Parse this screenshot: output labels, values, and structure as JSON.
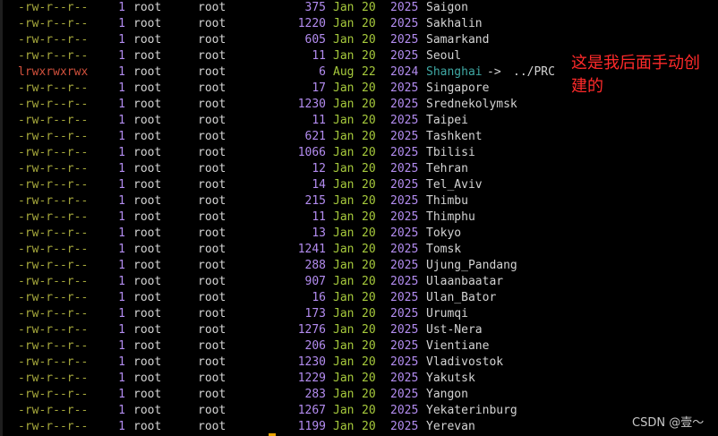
{
  "listing": {
    "entries": [
      {
        "perm": "-rw-r--r--",
        "links": "1",
        "owner": "root",
        "group": "root",
        "size": "375",
        "month": "Jan",
        "day": "20",
        "year": "2025",
        "name": "Saigon"
      },
      {
        "perm": "-rw-r--r--",
        "links": "1",
        "owner": "root",
        "group": "root",
        "size": "1220",
        "month": "Jan",
        "day": "20",
        "year": "2025",
        "name": "Sakhalin"
      },
      {
        "perm": "-rw-r--r--",
        "links": "1",
        "owner": "root",
        "group": "root",
        "size": "605",
        "month": "Jan",
        "day": "20",
        "year": "2025",
        "name": "Samarkand"
      },
      {
        "perm": "-rw-r--r--",
        "links": "1",
        "owner": "root",
        "group": "root",
        "size": "11",
        "month": "Jan",
        "day": "20",
        "year": "2025",
        "name": "Seoul"
      },
      {
        "perm": "lrwxrwxrwx",
        "links": "1",
        "owner": "root",
        "group": "root",
        "size": "6",
        "month": "Aug",
        "day": "22",
        "year": "2024",
        "name": "Shanghai",
        "arrow": "->",
        "target": "../PRC",
        "is_link": true
      },
      {
        "perm": "-rw-r--r--",
        "links": "1",
        "owner": "root",
        "group": "root",
        "size": "17",
        "month": "Jan",
        "day": "20",
        "year": "2025",
        "name": "Singapore"
      },
      {
        "perm": "-rw-r--r--",
        "links": "1",
        "owner": "root",
        "group": "root",
        "size": "1230",
        "month": "Jan",
        "day": "20",
        "year": "2025",
        "name": "Srednekolymsk"
      },
      {
        "perm": "-rw-r--r--",
        "links": "1",
        "owner": "root",
        "group": "root",
        "size": "11",
        "month": "Jan",
        "day": "20",
        "year": "2025",
        "name": "Taipei"
      },
      {
        "perm": "-rw-r--r--",
        "links": "1",
        "owner": "root",
        "group": "root",
        "size": "621",
        "month": "Jan",
        "day": "20",
        "year": "2025",
        "name": "Tashkent"
      },
      {
        "perm": "-rw-r--r--",
        "links": "1",
        "owner": "root",
        "group": "root",
        "size": "1066",
        "month": "Jan",
        "day": "20",
        "year": "2025",
        "name": "Tbilisi"
      },
      {
        "perm": "-rw-r--r--",
        "links": "1",
        "owner": "root",
        "group": "root",
        "size": "12",
        "month": "Jan",
        "day": "20",
        "year": "2025",
        "name": "Tehran"
      },
      {
        "perm": "-rw-r--r--",
        "links": "1",
        "owner": "root",
        "group": "root",
        "size": "14",
        "month": "Jan",
        "day": "20",
        "year": "2025",
        "name": "Tel_Aviv"
      },
      {
        "perm": "-rw-r--r--",
        "links": "1",
        "owner": "root",
        "group": "root",
        "size": "215",
        "month": "Jan",
        "day": "20",
        "year": "2025",
        "name": "Thimbu"
      },
      {
        "perm": "-rw-r--r--",
        "links": "1",
        "owner": "root",
        "group": "root",
        "size": "11",
        "month": "Jan",
        "day": "20",
        "year": "2025",
        "name": "Thimphu"
      },
      {
        "perm": "-rw-r--r--",
        "links": "1",
        "owner": "root",
        "group": "root",
        "size": "13",
        "month": "Jan",
        "day": "20",
        "year": "2025",
        "name": "Tokyo"
      },
      {
        "perm": "-rw-r--r--",
        "links": "1",
        "owner": "root",
        "group": "root",
        "size": "1241",
        "month": "Jan",
        "day": "20",
        "year": "2025",
        "name": "Tomsk"
      },
      {
        "perm": "-rw-r--r--",
        "links": "1",
        "owner": "root",
        "group": "root",
        "size": "288",
        "month": "Jan",
        "day": "20",
        "year": "2025",
        "name": "Ujung_Pandang"
      },
      {
        "perm": "-rw-r--r--",
        "links": "1",
        "owner": "root",
        "group": "root",
        "size": "907",
        "month": "Jan",
        "day": "20",
        "year": "2025",
        "name": "Ulaanbaatar"
      },
      {
        "perm": "-rw-r--r--",
        "links": "1",
        "owner": "root",
        "group": "root",
        "size": "16",
        "month": "Jan",
        "day": "20",
        "year": "2025",
        "name": "Ulan_Bator"
      },
      {
        "perm": "-rw-r--r--",
        "links": "1",
        "owner": "root",
        "group": "root",
        "size": "173",
        "month": "Jan",
        "day": "20",
        "year": "2025",
        "name": "Urumqi"
      },
      {
        "perm": "-rw-r--r--",
        "links": "1",
        "owner": "root",
        "group": "root",
        "size": "1276",
        "month": "Jan",
        "day": "20",
        "year": "2025",
        "name": "Ust-Nera"
      },
      {
        "perm": "-rw-r--r--",
        "links": "1",
        "owner": "root",
        "group": "root",
        "size": "206",
        "month": "Jan",
        "day": "20",
        "year": "2025",
        "name": "Vientiane"
      },
      {
        "perm": "-rw-r--r--",
        "links": "1",
        "owner": "root",
        "group": "root",
        "size": "1230",
        "month": "Jan",
        "day": "20",
        "year": "2025",
        "name": "Vladivostok"
      },
      {
        "perm": "-rw-r--r--",
        "links": "1",
        "owner": "root",
        "group": "root",
        "size": "1229",
        "month": "Jan",
        "day": "20",
        "year": "2025",
        "name": "Yakutsk"
      },
      {
        "perm": "-rw-r--r--",
        "links": "1",
        "owner": "root",
        "group": "root",
        "size": "283",
        "month": "Jan",
        "day": "20",
        "year": "2025",
        "name": "Yangon"
      },
      {
        "perm": "-rw-r--r--",
        "links": "1",
        "owner": "root",
        "group": "root",
        "size": "1267",
        "month": "Jan",
        "day": "20",
        "year": "2025",
        "name": "Yekaterinburg"
      },
      {
        "perm": "-rw-r--r--",
        "links": "1",
        "owner": "root",
        "group": "root",
        "size": "1199",
        "month": "Jan",
        "day": "20",
        "year": "2025",
        "name": "Yerevan"
      }
    ]
  },
  "annotation": {
    "text": "这是我后面手动创建的"
  },
  "watermark": {
    "text": "CSDN @壹～"
  },
  "colors": {
    "background": "#000000",
    "perm_file": "#a6a83c",
    "perm_link": "#d0503c",
    "number": "#b38cf0",
    "date": "#a6c93c",
    "symlink_name": "#3fa8a4",
    "text": "#d4d4d4",
    "annotation": "#ff2a2a"
  }
}
